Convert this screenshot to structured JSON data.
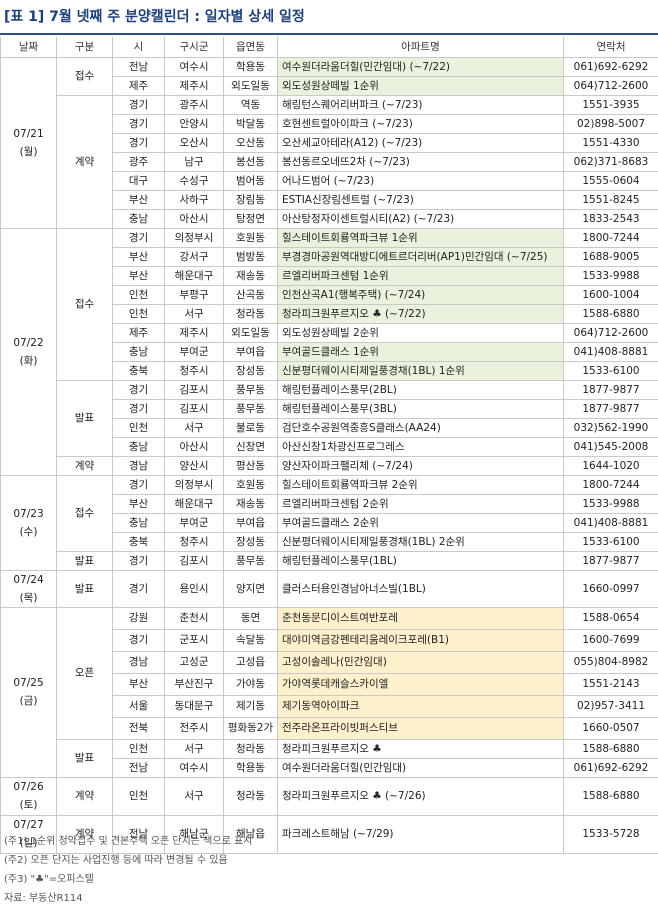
{
  "title": "[표 1] 7월 넷째 주 분양캘린더 : 일자별 상세 일정",
  "headers": [
    "날짜",
    "구분",
    "시",
    "구시군",
    "읍면동",
    "아파트명",
    "연락처"
  ],
  "dates": [
    {
      "md": "07/21",
      "dow": "(월)"
    },
    {
      "md": "07/22",
      "dow": "(화)"
    },
    {
      "md": "07/23",
      "dow": "(수)"
    },
    {
      "md": "07/24",
      "dow": "(목)"
    },
    {
      "md": "07/25",
      "dow": "(금)"
    },
    {
      "md": "07/26",
      "dow": "(토)"
    },
    {
      "md": "07/27",
      "dow": "(일)"
    }
  ],
  "types": {
    "receipt": "접수",
    "contract": "계약",
    "announce": "발표",
    "open": "오픈"
  },
  "rows": [
    {
      "si": "전남",
      "gu": "여수시",
      "dong": "학용동",
      "apt": "여수원더라움더힐(민간임대) (~7/22)",
      "tel": "061)692-6292"
    },
    {
      "si": "제주",
      "gu": "제주시",
      "dong": "외도일동",
      "apt": "외도성원상떼빌 1순위",
      "tel": "064)712-2600"
    },
    {
      "si": "경기",
      "gu": "광주시",
      "dong": "역동",
      "apt": "해링턴스퀘어리버파크 (~7/23)",
      "tel": "1551-3935"
    },
    {
      "si": "경기",
      "gu": "안양시",
      "dong": "박달동",
      "apt": "호현센트럴아이파크 (~7/23)",
      "tel": "02)898-5007"
    },
    {
      "si": "경기",
      "gu": "오산시",
      "dong": "오산동",
      "apt": "오산세교아테라(A12) (~7/23)",
      "tel": "1551-4330"
    },
    {
      "si": "광주",
      "gu": "남구",
      "dong": "봉선동",
      "apt": "봉선동르오네뜨2차 (~7/23)",
      "tel": "062)371-8683"
    },
    {
      "si": "대구",
      "gu": "수성구",
      "dong": "범어동",
      "apt": "어나드범어 (~7/23)",
      "tel": "1555-0604"
    },
    {
      "si": "부산",
      "gu": "사하구",
      "dong": "장림동",
      "apt": "ESTIA신장림센트럴 (~7/23)",
      "tel": "1551-8245"
    },
    {
      "si": "충남",
      "gu": "아산시",
      "dong": "탕정면",
      "apt": "아산탕정자이센트럴시티(A2) (~7/23)",
      "tel": "1833-2543"
    },
    {
      "si": "경기",
      "gu": "의정부시",
      "dong": "호원동",
      "apt": "힐스테이트회룡역파크뷰 1순위",
      "tel": "1800-7244"
    },
    {
      "si": "부산",
      "gu": "강서구",
      "dong": "범방동",
      "apt": "부경경마공원역대방디에트르더리버(AP1)민간임대 (~7/25)",
      "tel": "1688-9005"
    },
    {
      "si": "부산",
      "gu": "해운대구",
      "dong": "재송동",
      "apt": "르엘리버파크센텀 1순위",
      "tel": "1533-9988"
    },
    {
      "si": "인천",
      "gu": "부평구",
      "dong": "산곡동",
      "apt": "인천산곡A1(행복주택) (~7/24)",
      "tel": "1600-1004"
    },
    {
      "si": "인천",
      "gu": "서구",
      "dong": "청라동",
      "apt": "청라피크원푸르지오 ♣ (~7/22)",
      "tel": "1588-6880"
    },
    {
      "si": "제주",
      "gu": "제주시",
      "dong": "외도일동",
      "apt": "외도성원상떼빌 2순위",
      "tel": "064)712-2600"
    },
    {
      "si": "충남",
      "gu": "부여군",
      "dong": "부여읍",
      "apt": "부여골드클래스 1순위",
      "tel": "041)408-8881"
    },
    {
      "si": "충북",
      "gu": "청주시",
      "dong": "장성동",
      "apt": "신분평더웨이시티제일풍경채(1BL) 1순위",
      "tel": "1533-6100"
    },
    {
      "si": "경기",
      "gu": "김포시",
      "dong": "풍무동",
      "apt": "해링턴플레이스풍무(2BL)",
      "tel": "1877-9877"
    },
    {
      "si": "경기",
      "gu": "김포시",
      "dong": "풍무동",
      "apt": "해링턴플레이스풍무(3BL)",
      "tel": "1877-9877"
    },
    {
      "si": "인천",
      "gu": "서구",
      "dong": "불로동",
      "apt": "검단호수공원역중흥S클래스(AA24)",
      "tel": "032)562-1990"
    },
    {
      "si": "충남",
      "gu": "아산시",
      "dong": "신창면",
      "apt": "아산신창1차광신프로그레스",
      "tel": "041)545-2008"
    },
    {
      "si": "경남",
      "gu": "양산시",
      "dong": "평산동",
      "apt": "양산자이파크팰리체 (~7/24)",
      "tel": "1644-1020"
    },
    {
      "si": "경기",
      "gu": "의정부시",
      "dong": "호원동",
      "apt": "힐스테이트회룡역파크뷰 2순위",
      "tel": "1800-7244"
    },
    {
      "si": "부산",
      "gu": "해운대구",
      "dong": "재송동",
      "apt": "르엘리버파크센텀 2순위",
      "tel": "1533-9988"
    },
    {
      "si": "충남",
      "gu": "부여군",
      "dong": "부여읍",
      "apt": "부여골드클래스 2순위",
      "tel": "041)408-8881"
    },
    {
      "si": "충북",
      "gu": "청주시",
      "dong": "장성동",
      "apt": "신분평더웨이시티제일풍경채(1BL) 2순위",
      "tel": "1533-6100"
    },
    {
      "si": "경기",
      "gu": "김포시",
      "dong": "풍무동",
      "apt": "해링턴플레이스풍무(1BL)",
      "tel": "1877-9877"
    },
    {
      "si": "경기",
      "gu": "용인시",
      "dong": "양지면",
      "apt": "클러스터용인경남아너스빌(1BL)",
      "tel": "1660-0997"
    },
    {
      "si": "강원",
      "gu": "춘천시",
      "dong": "동면",
      "apt": "춘천동문디이스트여반포레",
      "tel": "1588-0654"
    },
    {
      "si": "경기",
      "gu": "군포시",
      "dong": "속달동",
      "apt": "대야미역금강펜테리움레이크포레(B1)",
      "tel": "1600-7699"
    },
    {
      "si": "경남",
      "gu": "고성군",
      "dong": "고성읍",
      "apt": "고성이솔레나(민간임대)",
      "tel": "055)804-8982"
    },
    {
      "si": "부산",
      "gu": "부산진구",
      "dong": "가야동",
      "apt": "가야역롯데캐슬스카이엘",
      "tel": "1551-2143"
    },
    {
      "si": "서울",
      "gu": "동대문구",
      "dong": "제기동",
      "apt": "제기동역아이파크",
      "tel": "02)957-3411"
    },
    {
      "si": "전북",
      "gu": "전주시",
      "dong": "평화동2가",
      "apt": "전주라온프라이빗퍼스티브",
      "tel": "1660-0507"
    },
    {
      "si": "인천",
      "gu": "서구",
      "dong": "청라동",
      "apt": "청라피크원푸르지오 ♣",
      "tel": "1588-6880"
    },
    {
      "si": "전남",
      "gu": "여수시",
      "dong": "학용동",
      "apt": "여수원더라움더힐(민간임대)",
      "tel": "061)692-6292"
    },
    {
      "si": "인천",
      "gu": "서구",
      "dong": "청라동",
      "apt": "청라피크원푸르지오 ♣ (~7/26)",
      "tel": "1588-6880"
    },
    {
      "si": "전남",
      "gu": "해남군",
      "dong": "해남읍",
      "apt": "파크레스트해남 (~7/29)",
      "tel": "1533-5728"
    }
  ],
  "notes": [
    "(주1) 1순위 청약접수 및 견본주택 오픈 단지는 색으로 표시",
    "(주2) 오픈 단지는 사업진행 등에 따라 변경될 수 있음",
    "(주3) \"♣\"=오피스텔",
    "자료: 부동산R114"
  ],
  "colors": {
    "title": "#1e3f7a",
    "receipt_fill": "#e8f2dc",
    "open_fill": "#fdf0cc"
  }
}
